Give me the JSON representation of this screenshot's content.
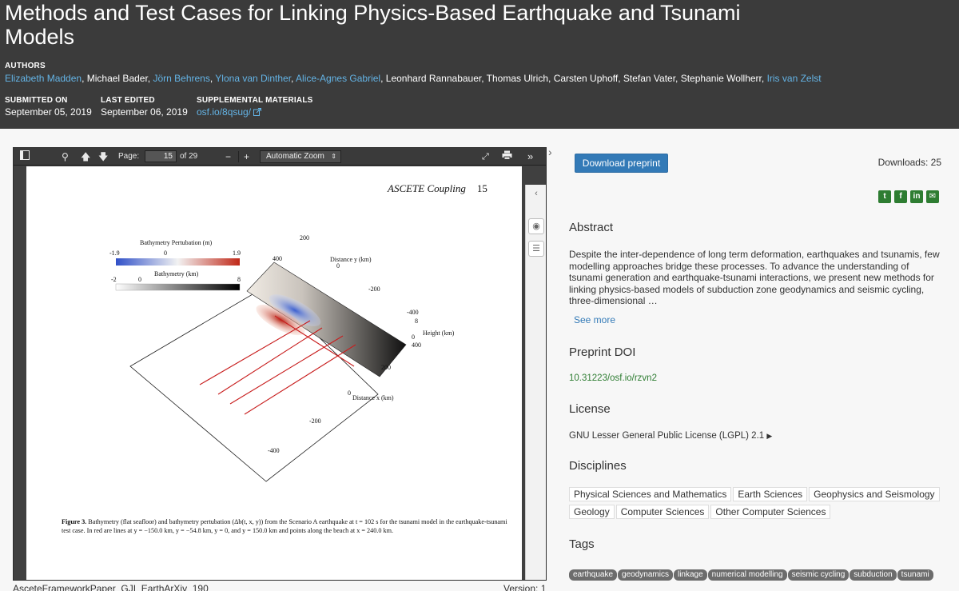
{
  "header": {
    "title": "Methods and Test Cases for Linking Physics-Based Earthquake and Tsunami Models",
    "authors_label": "AUTHORS",
    "authors": [
      {
        "name": "Elizabeth Madden",
        "linked": true
      },
      {
        "name": "Michael Bader",
        "linked": false
      },
      {
        "name": "Jörn Behrens",
        "linked": true
      },
      {
        "name": "Ylona van Dinther",
        "linked": true
      },
      {
        "name": "Alice-Agnes Gabriel",
        "linked": true
      },
      {
        "name": "Leonhard Rannabauer",
        "linked": false
      },
      {
        "name": "Thomas Ulrich",
        "linked": false
      },
      {
        "name": "Carsten Uphoff",
        "linked": false
      },
      {
        "name": "Stefan Vater",
        "linked": false
      },
      {
        "name": "Stephanie Wollherr",
        "linked": false
      },
      {
        "name": "Iris van Zelst",
        "linked": true
      }
    ],
    "submitted_label": "SUBMITTED ON",
    "submitted": "September 05, 2019",
    "edited_label": "LAST EDITED",
    "edited": "September 06, 2019",
    "supp_label": "SUPPLEMENTAL MATERIALS",
    "supp_link": "osf.io/8qsug/"
  },
  "viewer": {
    "page_label": "Page:",
    "page_current": "15",
    "page_total": "of 29",
    "zoom": "Automatic Zoom",
    "page": {
      "running_head": "ASCETE Coupling",
      "page_number": "15",
      "figure": {
        "colorbar1_title": "Bathymetry Pertubation (m)",
        "colorbar1_ticks": [
          "-1.9",
          "0",
          "1.9"
        ],
        "colorbar2_title": "Bathymetry (km)",
        "colorbar2_ticks": [
          "-2",
          "0",
          "8"
        ],
        "y_axis_label": "Distance y (km)",
        "y_ticks": [
          "400",
          "200",
          "0",
          "-200",
          "-400"
        ],
        "x_axis_label": "Distance x (km)",
        "x_ticks": [
          "400",
          "200",
          "0",
          "-200",
          "-400"
        ],
        "z_axis_label": "Height (km)",
        "z_ticks": [
          "8",
          "0"
        ]
      },
      "caption_lead": "Figure 3.",
      "caption_text": "Bathymetry (flat seafloor) and bathymetry pertubation (Δb(t, x, y)) from the Scenario A earthquake at t = 102 s for the tsunami model in the earthquake-tsunami test case. In red are lines at y = −150.0 km, y = −54.8 km, y = 0, and y = 150.0 km and points along the beach at x = 240.0 km."
    },
    "file_name": "AsceteFrameworkPaper_GJI_EarthArXiv_190",
    "version": "Version: 1"
  },
  "panel": {
    "download_label": "Download preprint",
    "downloads": "Downloads: 25",
    "share_icons": [
      "twitter-icon",
      "facebook-icon",
      "linkedin-icon",
      "email-icon"
    ],
    "abstract_heading": "Abstract",
    "abstract": "Despite the inter-dependence of long term deformation, earthquakes and tsunamis, few modelling approaches bridge these processes. To advance the understanding of tsunami generation and earthquake-tsunami interactions, we present new methods for linking physics-based models of subduction zone geodynamics and seismic cycling, three-dimensional …",
    "see_more": "See more",
    "doi_heading": "Preprint DOI",
    "doi": "10.31223/osf.io/rzvn2",
    "license_heading": "License",
    "license": "GNU Lesser General Public License (LGPL) 2.1",
    "disciplines_heading": "Disciplines",
    "disciplines": [
      "Physical Sciences and Mathematics",
      "Earth Sciences",
      "Geophysics and Seismology",
      "Geology",
      "Computer Sciences",
      "Other Computer Sciences"
    ],
    "tags_heading": "Tags",
    "tags": [
      "earthquake",
      "geodynamics",
      "linkage",
      "numerical modelling",
      "seismic cycling",
      "subduction",
      "tsunami"
    ]
  },
  "colors": {
    "header_bg": "#3b3b3b",
    "author_link": "#64b4e6",
    "accent_blue": "#337ab7",
    "accent_green": "#2e7d32"
  }
}
